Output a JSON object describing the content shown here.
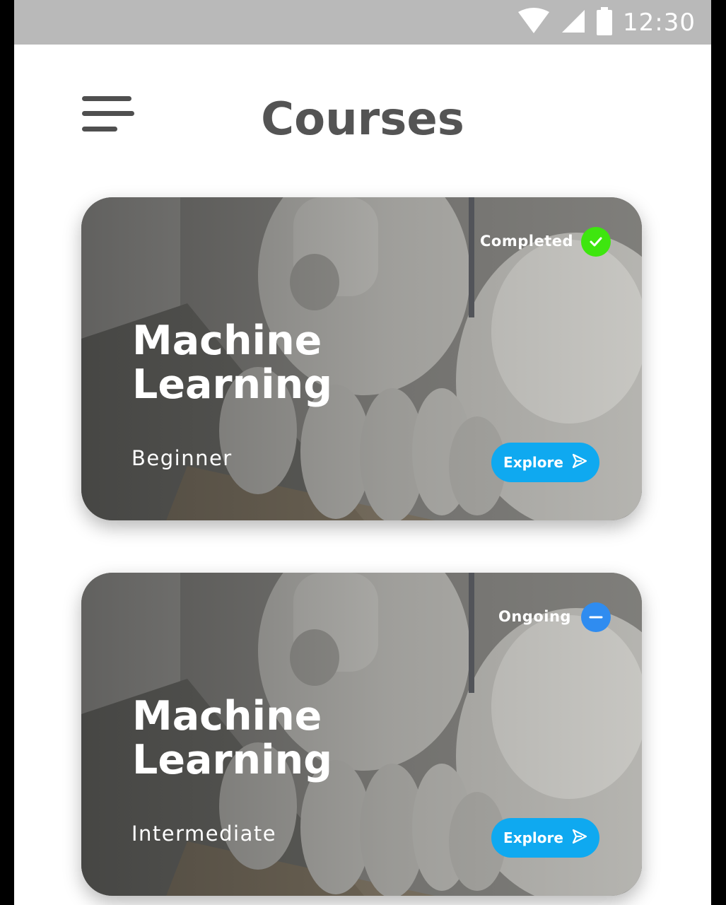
{
  "status_bar": {
    "time": "12:30",
    "icons": [
      "wifi-icon",
      "cellular-signal-icon",
      "battery-icon"
    ]
  },
  "header": {
    "title": "Courses",
    "menu_icon": "hamburger-menu-icon"
  },
  "colors": {
    "status_bar_bg": "#b9b9b9",
    "title_text": "#545454",
    "explore_button": "#0fa9f0",
    "completed_badge": "#3ee60f",
    "ongoing_badge": "#2f8cf0"
  },
  "courses": [
    {
      "status": "Completed",
      "status_icon": "check-icon",
      "title_line1": "Machine",
      "title_line2": "Learning",
      "level": "Beginner",
      "action": "Explore",
      "action_icon": "send-arrow-icon"
    },
    {
      "status": "Ongoing",
      "status_icon": "minus-icon",
      "title_line1": "Machine",
      "title_line2": "Learning",
      "level": "Intermediate",
      "action": "Explore",
      "action_icon": "send-arrow-icon"
    }
  ]
}
